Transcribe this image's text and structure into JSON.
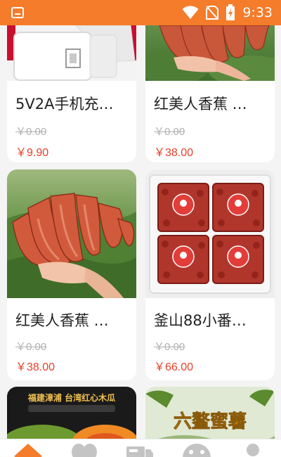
{
  "status_bar": {
    "time": "9:33",
    "background": "#f57c2a",
    "icons": [
      "app-badge-icon",
      "wifi-icon",
      "no-sim-icon",
      "battery-charging-icon"
    ]
  },
  "products": [
    {
      "title": "5V2A手机充…",
      "original_price": "￥0.00",
      "price": "￥9.90",
      "image": "phone-charger"
    },
    {
      "title": "红美人香蕉 …",
      "original_price": "￥0.00",
      "price": "￥38.00",
      "image": "red-banana"
    },
    {
      "title": "红美人香蕉 …",
      "original_price": "￥0.00",
      "price": "￥38.00",
      "image": "red-banana"
    },
    {
      "title": "釜山88小番…",
      "original_price": "￥0.00",
      "price": "￥66.00",
      "image": "cherry-tomato-boxes"
    },
    {
      "title": "",
      "image": "papaya",
      "banner_text": "福建漳浦 台湾红心木瓜"
    },
    {
      "title": "",
      "image": "honey-melon",
      "banner_text": "六鳌蜜薯"
    }
  ],
  "tab_bar": {
    "active_color": "#f57c2a",
    "inactive_color": "#c4c4c4",
    "tabs": [
      "home-icon",
      "category-icon",
      "truck-icon",
      "message-icon",
      "profile-icon"
    ]
  }
}
